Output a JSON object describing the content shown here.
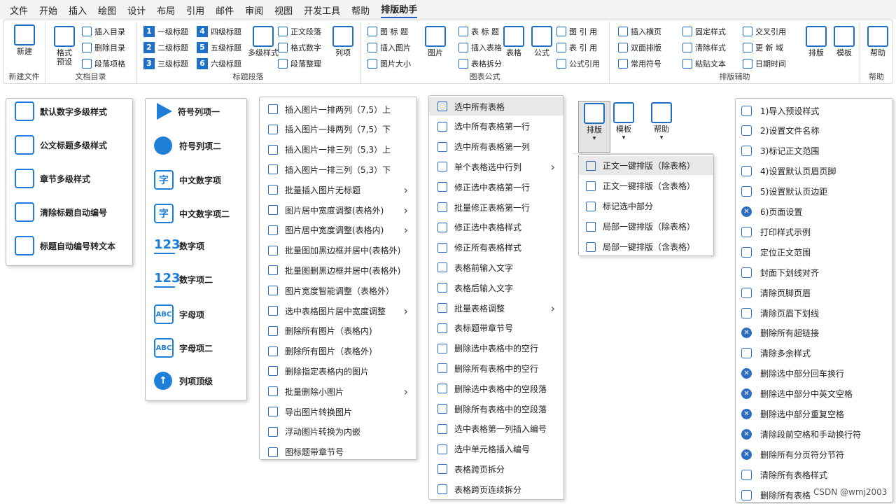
{
  "tabs": [
    "文件",
    "开始",
    "插入",
    "绘图",
    "设计",
    "布局",
    "引用",
    "邮件",
    "审阅",
    "视图",
    "开发工具",
    "帮助",
    "排版助手"
  ],
  "ribbon": {
    "groups": {
      "new": "新建文件",
      "toc": "文档目录",
      "headings": "标题段落",
      "charts": "图表公式",
      "layout": "排版辅助",
      "help": "帮助"
    },
    "new_btn": "新建",
    "preset_btn": "格式\n预设",
    "toc_items": [
      "插入目录",
      "删除目录",
      "段落项格"
    ],
    "heading_items": [
      [
        "1",
        "一级标题"
      ],
      [
        "2",
        "二级标题"
      ],
      [
        "3",
        "三级标题"
      ],
      [
        "4",
        "四级标题"
      ],
      [
        "5",
        "五级标题"
      ],
      [
        "6",
        "六级标题"
      ]
    ],
    "multilevel_btn": "多级样式",
    "para_items": [
      "正文段落",
      "格式数字",
      "段落整理"
    ],
    "list_btn": "列项",
    "img_items": [
      "图 标 题",
      "插入图片",
      "图片大小"
    ],
    "img_btn": "图片",
    "table_items": [
      "表 标 题",
      "插入表格",
      "表格拆分"
    ],
    "table_btn": "表格",
    "formula_btn": "公式",
    "ref_items": [
      "图 引 用",
      "表 引 用",
      "公式引用"
    ],
    "aux_col1": [
      "插入横页",
      "双面排版",
      "常用符号"
    ],
    "aux_col2": [
      "固定样式",
      "清除样式",
      "粘贴文本"
    ],
    "aux_col3": [
      "交叉引用",
      "更 新 域",
      "日期时间"
    ],
    "layout_btn": "排版",
    "template_btn": "模板",
    "help_btn": "帮助"
  },
  "menu1": [
    "默认数字多级样式",
    "公文标题多级样式",
    "章节多级样式",
    "清除标题自动编号",
    "标题自动编号转文本"
  ],
  "menu2": [
    "符号列项一",
    "符号列项二",
    "中文数字项",
    "中文数字项二",
    "数字项",
    "数字项二",
    "字母项",
    "字母项二",
    "列项顶级"
  ],
  "menu2_glyphs": [
    "字",
    "字",
    "123",
    "123",
    "ABC",
    "ABC",
    "↑"
  ],
  "menu3": [
    "插入图片一排两列（7,5）上",
    "插入图片一排两列（7,5）下",
    "插入图片一排三列（5,3）上",
    "插入图片一排三列（5,3）下",
    "批量插入图片无标题",
    "图片居中宽度调整(表格外)",
    "图片居中宽度调整(表格内)",
    "批量图加黑边框并居中(表格外)",
    "批量图删黑边框并居中(表格外)",
    "图片宽度智能调整（表格外）",
    "选中表格图片居中宽度调整",
    "删除所有图片（表格内)",
    "删除所有图片（表格外)",
    "删除指定表格内的图片",
    "批量删除小图片",
    "导出图片转换图片",
    "浮动图片转换为内嵌",
    "图标题带章节号"
  ],
  "menu3_arrows": [
    4,
    5,
    6,
    10,
    14
  ],
  "menu4": [
    "选中所有表格",
    "选中所有表格第一行",
    "选中所有表格第一列",
    "单个表格选中行列",
    "修正选中表格第一行",
    "批量修正表格第一行",
    "修正选中表格样式",
    "修正所有表格样式",
    "表格前输入文字",
    "表格后输入文字",
    "批量表格调整",
    "表标题带章节号",
    "删除选中表格中的空行",
    "删除所有表格中的空行",
    "删除选中表格中的空段落",
    "删除所有表格中的空段落",
    "选中表格第一列插入编号",
    "选中单元格插入编号",
    "表格跨页拆分",
    "表格跨页连续拆分"
  ],
  "menu4_arrows": [
    3,
    10
  ],
  "mini": {
    "layout": "排版",
    "template": "模板",
    "help": "帮助"
  },
  "menu5": [
    "正文一键排版（除表格）",
    "正文一键排版（含表格）",
    "标记选中部分",
    "局部一键排版（除表格）",
    "局部一键排版（含表格）"
  ],
  "menu6": [
    "1)导入预设样式",
    "2)设置文件名称",
    "3)标记正文范围",
    "4)设置默认页眉页脚",
    "5)设置默认页边距",
    "6)页面设置",
    "打印样式示例",
    "定位正文范围",
    "封面下划线对齐",
    "清除页脚页眉",
    "清除页眉下划线",
    "删除所有超链接",
    "清除多余样式",
    "删除选中部分回车换行",
    "删除选中部分中英文空格",
    "删除选中部分重复空格",
    "清除段前空格和手动换行符",
    "删除所有分页符分节符",
    "清除所有表格样式",
    "删除所有表格"
  ],
  "menu6_x": [
    5,
    11,
    13,
    14,
    15,
    16,
    17
  ],
  "watermark": "CSDN @wmj2003",
  "accent": "#1e7ed8"
}
